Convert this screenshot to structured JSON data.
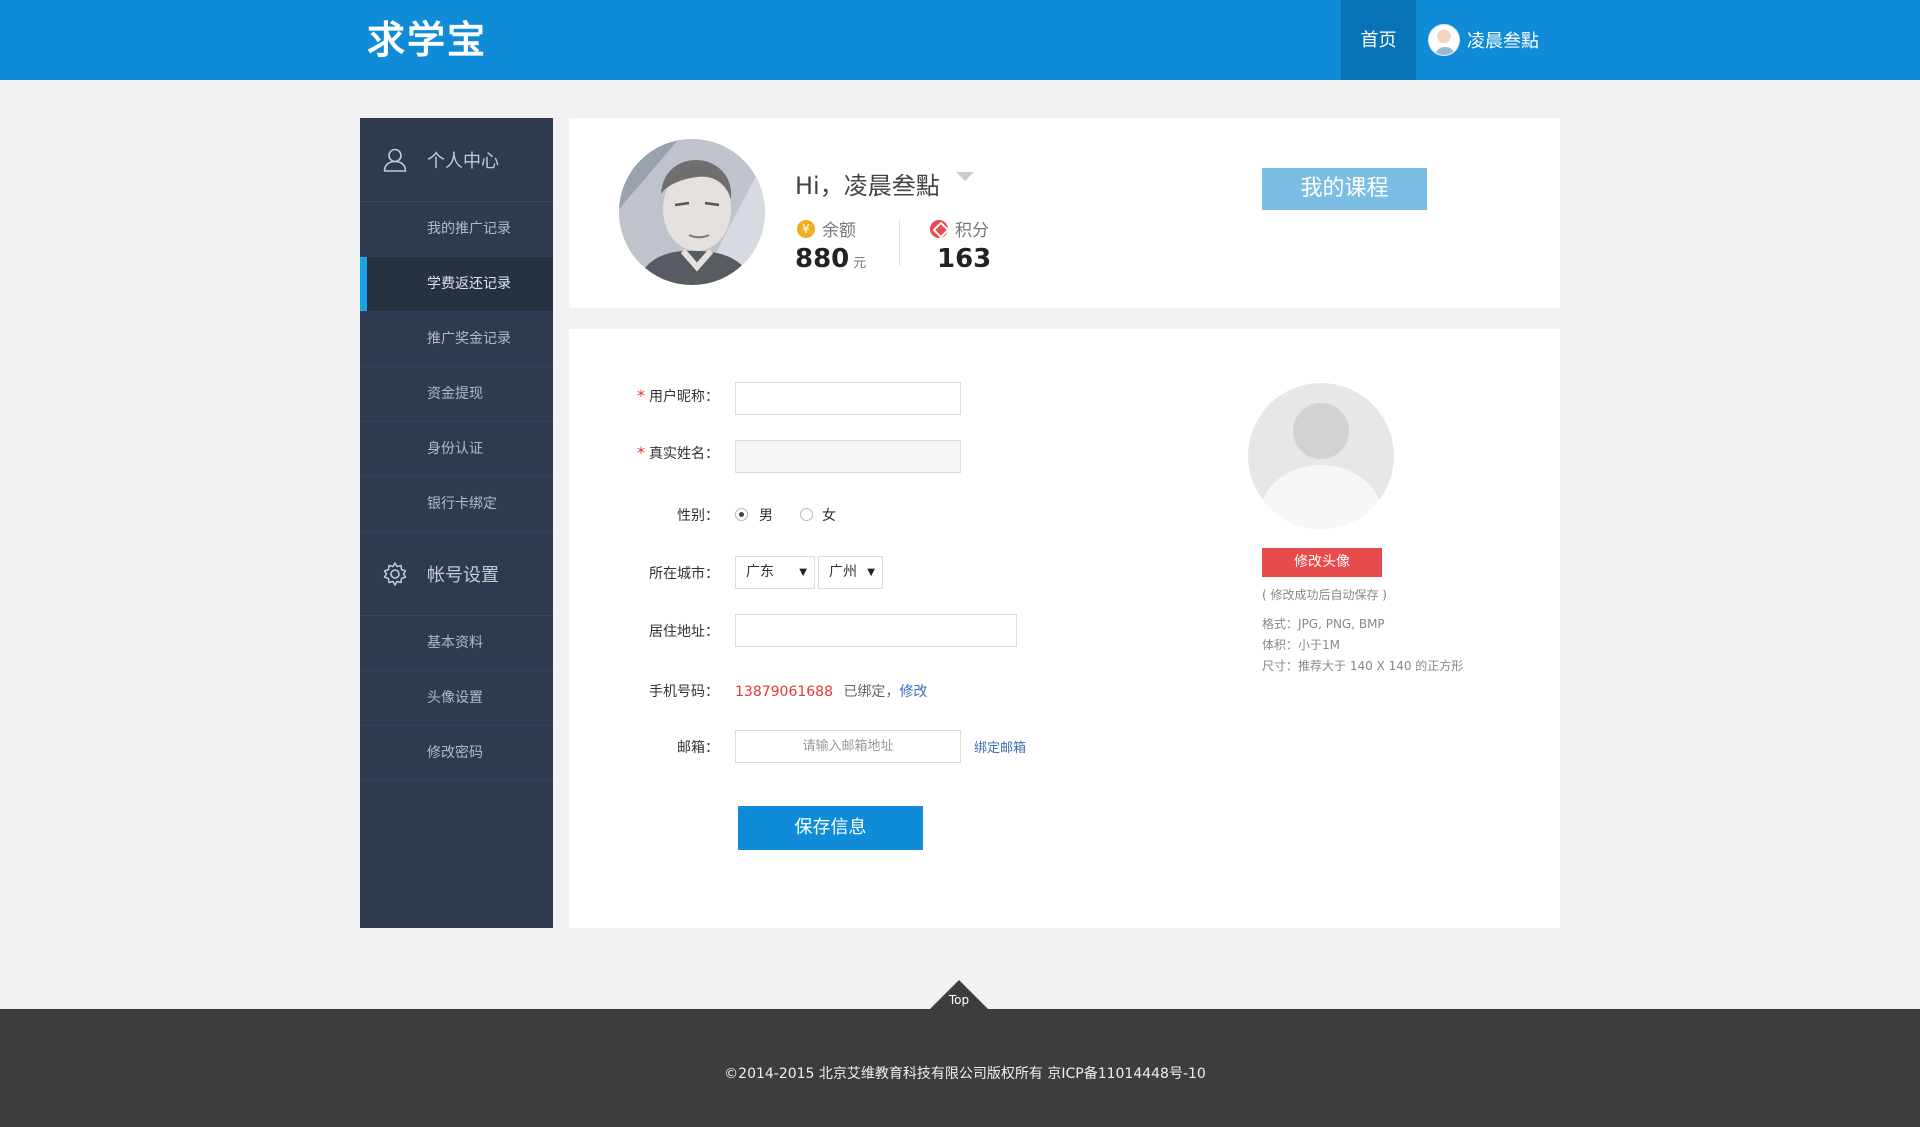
{
  "header": {
    "logo": "求学宝",
    "nav_home": "首页",
    "username": "凌晨叁點"
  },
  "sidebar": {
    "section1": {
      "title": "个人中心",
      "icon": "user-icon",
      "items": [
        "我的推广记录",
        "学费返还记录",
        "推广奖金记录",
        "资金提现",
        "身份认证",
        "银行卡绑定"
      ]
    },
    "section2": {
      "title": "帐号设置",
      "icon": "gear-icon",
      "items": [
        "基本资料",
        "头像设置",
        "修改密码"
      ]
    },
    "active_item": "学费返还记录"
  },
  "profile": {
    "greeting": "Hi，凌晨叁點",
    "balance_label": "余额",
    "balance_icon": "¥",
    "balance_value": "880",
    "balance_unit": "元",
    "points_label": "积分",
    "points_value": "163",
    "my_course_button": "我的课程"
  },
  "form": {
    "nickname_label": "用户昵称：",
    "realname_label": "真实姓名：",
    "required_mark": "*",
    "gender_label": "性别：",
    "gender_options": [
      "男",
      "女"
    ],
    "gender_selected": "男",
    "city_label": "所在城市：",
    "province_value": "广东",
    "city_value": "广州",
    "address_label": "居住地址：",
    "phone_label": "手机号码：",
    "phone_value": "13879061688",
    "phone_bound_text": "已绑定，",
    "phone_modify_link": "修改",
    "email_label": "邮箱：",
    "email_placeholder": "请输入邮箱地址",
    "email_bind_link": "绑定邮箱",
    "save_button": "保存信息"
  },
  "avatar_panel": {
    "change_button": "修改头像",
    "auto_save_tip": "( 修改成功后自动保存 )",
    "format_tip": "格式：JPG, PNG, BMP",
    "size_tip": "体积：小于1M",
    "dimension_tip": "尺寸：推荐大于 140 X 140 的正方形"
  },
  "footer": {
    "top_label": "Top",
    "copyright": "©2014-2015 北京艾维教育科技有限公司版权所有 京ICP备11014448号-10"
  },
  "colors": {
    "header_blue": "#0f8bd8",
    "sidebar_bg": "#2e3a4f",
    "active_bar": "#19a1e6",
    "phone_red": "#e53935",
    "change_avatar_red": "#e84b4b"
  }
}
